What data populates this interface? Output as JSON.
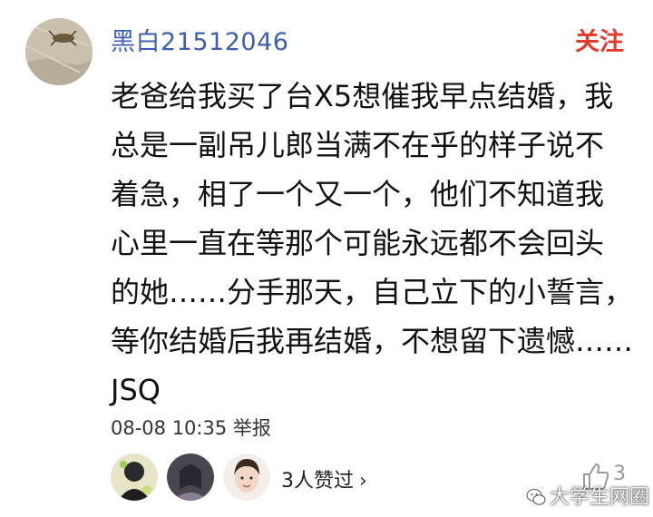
{
  "comment": {
    "author": "黑白21512046",
    "follow_label": "关注",
    "lines": [
      "老爸给我买了台X5想催我早点结婚，我",
      "总是一副吊儿郎当满不在乎的样子说不",
      "着急，相了一个又一个，他们不知道我",
      "心里一直在等那个可能永远都不会回头",
      "的她……分手那天，自己立下的小誓言，",
      "等你结婚后我再结婚，不想留下遗憾……",
      "JSQ"
    ],
    "timestamp": "08-08 10:35",
    "report_label": "举报"
  },
  "likes": {
    "summary": "3人赞过",
    "count": "3",
    "icon": "thumbs-up-icon"
  },
  "watermark": {
    "text": "大学生网圈",
    "icon": "wechat-icon"
  },
  "colors": {
    "username": "#3f5fae",
    "follow": "#e23a2f",
    "text": "#111111"
  }
}
